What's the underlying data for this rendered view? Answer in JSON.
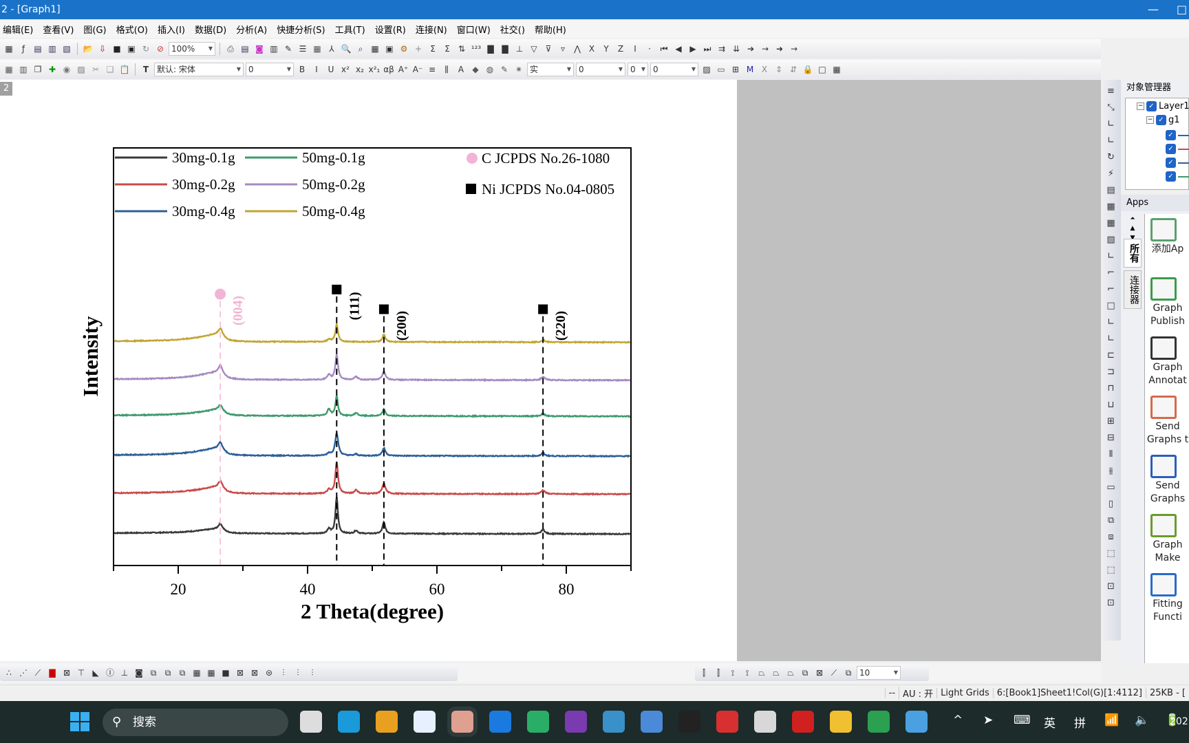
{
  "window": {
    "title": "2 - [Graph1]",
    "minimize": "—",
    "maximize": "□"
  },
  "menu": [
    "编辑(E)",
    "查看(V)",
    "图(G)",
    "格式(O)",
    "插入(I)",
    "数据(D)",
    "分析(A)",
    "快捷分析(S)",
    "工具(T)",
    "设置(R)",
    "连接(N)",
    "窗口(W)",
    "社交()",
    "帮助(H)"
  ],
  "toolbar1": {
    "zoom": "100%",
    "icons_a": [
      [
        "new-worksheet-icon",
        "▦",
        "#333"
      ],
      [
        "function-icon",
        "ƒ",
        "#333"
      ],
      [
        "new-graph-icon",
        "▤",
        "#335"
      ],
      [
        "new-matrix-icon",
        "▥",
        "#335"
      ],
      [
        "new-notes-icon",
        "▧",
        "#335"
      ]
    ],
    "icons_b": [
      [
        "open-icon",
        "📂",
        "#c90"
      ],
      [
        "import-icon",
        "⇩",
        "#c00"
      ],
      [
        "save-icon",
        "■",
        "#222"
      ],
      [
        "save-template-icon",
        "▣",
        "#222"
      ],
      [
        "recalc-icon",
        "↻",
        "#888"
      ],
      [
        "recalc-manual-icon",
        "⊘",
        "#c33"
      ]
    ],
    "icons_c": [
      [
        "print-icon",
        "⎙",
        "#555"
      ],
      [
        "preview-icon",
        "▤",
        "#335"
      ],
      [
        "page-icon",
        "◙",
        "#c3c"
      ],
      [
        "layer-icon",
        "▥",
        "#333"
      ],
      [
        "edit-icon",
        "✎",
        "#333"
      ],
      [
        "list-icon",
        "☰",
        "#333"
      ],
      [
        "table-icon",
        "▦",
        "#555"
      ],
      [
        "tree-icon",
        "⅄",
        "#333"
      ],
      [
        "zoom-in-icon",
        "🔍",
        "#090"
      ],
      [
        "zoom-data-icon",
        "⌕",
        "#236"
      ],
      [
        "worksheet-icon",
        "▦",
        "#333"
      ],
      [
        "script-icon",
        "▣",
        "#333"
      ],
      [
        "gear-icon",
        "⚙",
        "#a60"
      ],
      [
        "add-col-icon",
        "+",
        "#888"
      ],
      [
        "sum-icon",
        "Σ",
        "#333"
      ],
      [
        "stats-icon",
        "Σ",
        "#333"
      ],
      [
        "sort-icon",
        "⇅",
        "#333"
      ],
      [
        "count-icon",
        "¹²³",
        "#333"
      ],
      [
        "bar-chart-icon",
        "▇",
        "#333"
      ],
      [
        "column-icon",
        "▇",
        "#333"
      ],
      [
        "plot-icon",
        "⊥",
        "#333"
      ],
      [
        "filter-icon",
        "▽",
        "#333"
      ],
      [
        "filter-remove-icon",
        "⊽",
        "#333"
      ],
      [
        "filter-reapply-icon",
        "▿",
        "#333"
      ],
      [
        "peak-icon",
        "⋀",
        "#333"
      ],
      [
        "x-icon",
        "X",
        "#333"
      ],
      [
        "y-icon",
        "Y",
        "#333"
      ],
      [
        "z-icon",
        "Z",
        "#333"
      ],
      [
        "error-icon",
        "I",
        "#333"
      ],
      [
        "none-icon",
        "·",
        "#333"
      ],
      [
        "first-icon",
        "⏮",
        "#333"
      ],
      [
        "prev-icon",
        "◀",
        "#333"
      ],
      [
        "next-icon",
        "▶",
        "#333"
      ],
      [
        "last-icon",
        "⏭",
        "#333"
      ],
      [
        "move-right-icon",
        "⇉",
        "#333"
      ],
      [
        "move-down-icon",
        "⇊",
        "#333"
      ],
      [
        "arrow-right-icon",
        "➔",
        "#333"
      ],
      [
        "arrow-small-icon",
        "→",
        "#333"
      ],
      [
        "arrow-fwd-icon",
        "➜",
        "#333"
      ],
      [
        "arrow-end-icon",
        "→",
        "#333"
      ]
    ]
  },
  "toolbar2": {
    "icons_a": [
      [
        "grid-icon",
        "▦",
        "#555"
      ],
      [
        "grid2-icon",
        "▥",
        "#555"
      ],
      [
        "copy-format-icon",
        "❐",
        "#333"
      ],
      [
        "add-plot-icon",
        "✚",
        "#090"
      ],
      [
        "merge-icon",
        "◉",
        "#777"
      ],
      [
        "extract-icon",
        "▨",
        "#777"
      ],
      [
        "cut-icon",
        "✂",
        "#999"
      ],
      [
        "copy-icon",
        "❏",
        "#999"
      ],
      [
        "paste-icon",
        "📋",
        "#a80"
      ]
    ],
    "font": "默认: 宋体",
    "font_size": "0",
    "icons_b": [
      [
        "bold-icon",
        "B",
        "#333"
      ],
      [
        "italic-icon",
        "I",
        "#333"
      ],
      [
        "underline-icon",
        "U",
        "#333"
      ],
      [
        "superscript-icon",
        "x²",
        "#333"
      ],
      [
        "subscript-icon",
        "x₂",
        "#333"
      ],
      [
        "supsub-icon",
        "x²₁",
        "#333"
      ],
      [
        "greek-icon",
        "αβ",
        "#333"
      ],
      [
        "increase-font-icon",
        "A⁺",
        "#333"
      ],
      [
        "decrease-font-icon",
        "A⁻",
        "#333"
      ],
      [
        "align-icon",
        "≡",
        "#333"
      ],
      [
        "columns-icon",
        "⫼",
        "#333"
      ],
      [
        "font-color-icon",
        "A",
        "#333"
      ],
      [
        "fill-color-icon",
        "◆",
        "#555"
      ],
      [
        "pattern-icon",
        "◍",
        "#555"
      ],
      [
        "line-color-icon",
        "✎",
        "#555"
      ],
      [
        "shadow-icon",
        "✷",
        "#777"
      ]
    ],
    "line_style": "实",
    "line_width": "0",
    "color_value": "0",
    "icons_c": [
      [
        "fill-pattern-icon",
        "▨",
        "#333"
      ],
      [
        "border-icon",
        "▭",
        "#555"
      ],
      [
        "table-layout-icon",
        "⊞",
        "#333"
      ],
      [
        "mask-icon",
        "M",
        "#22a"
      ],
      [
        "unmask-icon",
        "X",
        "#888"
      ],
      [
        "spread-icon",
        "⇕",
        "#888"
      ],
      [
        "spread2-icon",
        "⇵",
        "#888"
      ],
      [
        "lock-icon",
        "🔒",
        "#888"
      ],
      [
        "frame-icon",
        "□",
        "#333"
      ],
      [
        "grid-table-icon",
        "▦",
        "#333"
      ]
    ]
  },
  "page_label": "2",
  "chart_data": {
    "type": "line",
    "xlabel": "2 Theta(degree)",
    "ylabel": "Intensity",
    "xlim": [
      10,
      90
    ],
    "ylim": [
      0,
      11
    ],
    "xticks": [
      20,
      40,
      60,
      80
    ],
    "xminor": [
      10,
      30,
      50,
      70,
      90
    ],
    "yticks": [],
    "grid": false,
    "legend_placement": "top-left",
    "series": [
      {
        "name": "30mg-0.1g",
        "color": "#3a3a3a",
        "offset": 0.85,
        "peaks": [
          [
            26.5,
            0.12,
            4
          ],
          [
            26.5,
            0.14,
            0.35
          ],
          [
            43.3,
            0.12,
            0.3
          ],
          [
            44.5,
            0.96,
            0.22
          ],
          [
            47.5,
            0.08,
            0.3
          ],
          [
            51.8,
            0.3,
            0.25
          ],
          [
            76.4,
            0.12,
            0.3
          ]
        ]
      },
      {
        "name": "30mg-0.2g",
        "color": "#c84a48",
        "offset": 1.9,
        "peaks": [
          [
            26.5,
            0.18,
            4
          ],
          [
            26.5,
            0.14,
            0.4
          ],
          [
            43.3,
            0.1,
            0.3
          ],
          [
            44.5,
            0.82,
            0.25
          ],
          [
            47.5,
            0.1,
            0.3
          ],
          [
            51.8,
            0.27,
            0.3
          ],
          [
            76.4,
            0.1,
            0.35
          ]
        ]
      },
      {
        "name": "30mg-0.4g",
        "color": "#2e5f96",
        "offset": 2.9,
        "peaks": [
          [
            26.5,
            0.2,
            4
          ],
          [
            26.5,
            0.15,
            0.35
          ],
          [
            43.3,
            0.06,
            0.3
          ],
          [
            44.5,
            0.58,
            0.3
          ],
          [
            47.5,
            0.04,
            0.3
          ],
          [
            51.8,
            0.2,
            0.3
          ],
          [
            76.4,
            0.08,
            0.3
          ]
        ]
      },
      {
        "name": "50mg-0.1g",
        "color": "#3f9a6c",
        "offset": 3.95,
        "peaks": [
          [
            26.5,
            0.16,
            4
          ],
          [
            26.5,
            0.13,
            0.35
          ],
          [
            43.3,
            0.18,
            0.3
          ],
          [
            44.5,
            0.53,
            0.22
          ],
          [
            47.5,
            0.08,
            0.3
          ],
          [
            51.8,
            0.18,
            0.25
          ],
          [
            76.4,
            0.07,
            0.3
          ]
        ]
      },
      {
        "name": "50mg-0.2g",
        "color": "#a48ac2",
        "offset": 4.9,
        "peaks": [
          [
            26.5,
            0.2,
            4
          ],
          [
            26.5,
            0.18,
            0.35
          ],
          [
            43.3,
            0.12,
            0.3
          ],
          [
            44.5,
            0.66,
            0.25
          ],
          [
            47.5,
            0.08,
            0.3
          ],
          [
            51.8,
            0.22,
            0.3
          ],
          [
            76.4,
            0.08,
            0.35
          ]
        ]
      },
      {
        "name": "50mg-0.4g",
        "color": "#c2a433",
        "offset": 5.9,
        "peaks": [
          [
            26.5,
            0.2,
            4
          ],
          [
            26.5,
            0.15,
            0.35
          ],
          [
            43.3,
            0.06,
            0.3
          ],
          [
            44.5,
            0.45,
            0.25
          ],
          [
            51.8,
            0.2,
            0.25
          ],
          [
            76.4,
            0.06,
            0.3
          ]
        ]
      }
    ],
    "reference_legend": [
      {
        "label": "C JCPDS No.26-1080",
        "marker": "circle",
        "color": "#f2b4d4"
      },
      {
        "label": "Ni JCPDS No.04-0805",
        "marker": "square",
        "color": "#000000"
      }
    ],
    "reference_peaks": [
      {
        "x": 26.5,
        "y": 7.15,
        "hkl": "(004)",
        "phase": "C",
        "color": "#f2b4d4"
      },
      {
        "x": 44.5,
        "y": 7.27,
        "hkl": "(111)",
        "phase": "Ni",
        "color": "#000000"
      },
      {
        "x": 51.8,
        "y": 6.75,
        "hkl": "(200)",
        "phase": "Ni",
        "color": "#000000"
      },
      {
        "x": 76.4,
        "y": 6.75,
        "hkl": "(220)",
        "phase": "Ni",
        "color": "#000000"
      }
    ]
  },
  "vtool_icons": [
    "speed-mode-icon",
    "rescale-xy-icon",
    "rescale-x-icon",
    "rescale-y-icon",
    "refresh-icon",
    "enable-speed-icon",
    "layout-icon",
    "grid-2x2-icon",
    "grid-3x2-icon",
    "grid-merge-icon",
    "axis-bl-icon",
    "axis-top-icon",
    "axis-right-icon",
    "axis-box-icon",
    "axis-l-icon",
    "axis-break-icon",
    "align-left-icon",
    "align-right-icon",
    "align-top-icon",
    "align-bottom-icon",
    "center-h-icon",
    "center-v-icon",
    "distribute-h-icon",
    "distribute-v-icon",
    "same-width-icon",
    "same-height-icon",
    "front-icon",
    "back-icon",
    "group-icon",
    "ungroup-icon",
    "resize-icon",
    "resize2-icon"
  ],
  "object_manager": {
    "title": "对象管理器",
    "layer": "Layer1",
    "group": "g1",
    "plots": [
      {
        "color": "#1f64c8"
      },
      {
        "color": "#c84a48"
      },
      {
        "color": "#2e5f96"
      },
      {
        "color": "#3f9a6c"
      }
    ]
  },
  "apps": {
    "title": "Apps",
    "tabs": [
      "所有",
      "连接器"
    ],
    "items": [
      {
        "label": "添加Ap",
        "color": "#5aa06a"
      },
      {
        "label": "Graph Publish",
        "color": "#3c9a4a"
      },
      {
        "label": "Graph Annotat",
        "color": "#333333"
      },
      {
        "label": "Send Graphs t",
        "color": "#d56a4a"
      },
      {
        "label": "Send Graphs",
        "color": "#2b5fb8"
      },
      {
        "label": "Graph Make",
        "color": "#6a9a30"
      },
      {
        "label": "Fitting Functi",
        "color": "#2a6ac8"
      }
    ]
  },
  "bottom_toolbar": {
    "value": "10"
  },
  "statusbar": [
    "--",
    "AU : 开",
    "Light Grids",
    "6:[Book1]Sheet1!Col(G)[1:4112]",
    "25KB - ["
  ],
  "taskbar": {
    "search": "搜索",
    "apps": [
      {
        "name": "task-view",
        "color": "#ddd"
      },
      {
        "name": "edge",
        "color": "#1a9ad8"
      },
      {
        "name": "chrome",
        "color": "#e8a020"
      },
      {
        "name": "baidu-netdisk",
        "color": "#e6f0ff"
      },
      {
        "name": "origin",
        "color": "#e0a090"
      },
      {
        "name": "mail",
        "color": "#1a7ae0"
      },
      {
        "name": "wechat",
        "color": "#2aae67"
      },
      {
        "name": "onenote",
        "color": "#7a3ab0"
      },
      {
        "name": "control-panel",
        "color": "#3a90c8"
      },
      {
        "name": "photos",
        "color": "#4a8ad8"
      },
      {
        "name": "qq",
        "color": "#222"
      },
      {
        "name": "wps",
        "color": "#d83030"
      },
      {
        "name": "snipping",
        "color": "#d8d8d8"
      },
      {
        "name": "recorder",
        "color": "#d02020"
      },
      {
        "name": "file-explorer",
        "color": "#f0c030"
      },
      {
        "name": "spreadsheet",
        "color": "#2aa050"
      },
      {
        "name": "notepad",
        "color": "#4aa0e0"
      }
    ],
    "tray": [
      "^",
      "➤",
      "⌨",
      "英",
      "拼",
      "📶",
      "🔈",
      "🔋"
    ],
    "clock": "202"
  }
}
